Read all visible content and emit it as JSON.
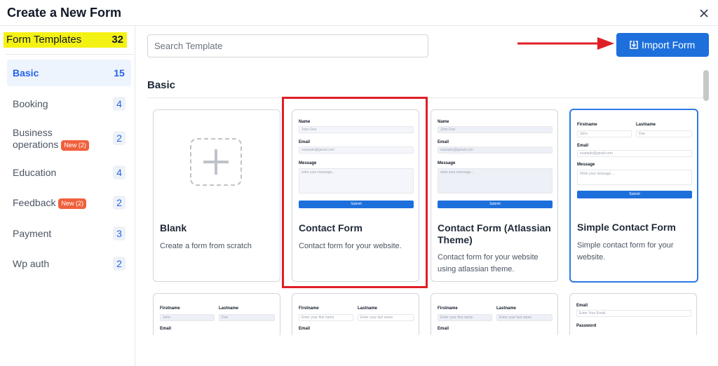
{
  "header": {
    "title": "Create a New Form"
  },
  "sidebar": {
    "heading": {
      "label": "Form Templates",
      "count": "32"
    },
    "items": [
      {
        "label": "Basic",
        "count": "15",
        "active": true
      },
      {
        "label": "Booking",
        "count": "4"
      },
      {
        "label": "Business",
        "label2": "operations",
        "badge": "New (2)",
        "count": "2"
      },
      {
        "label": "Education",
        "count": "4"
      },
      {
        "label": "Feedback",
        "badge": "New (2)",
        "count": "2"
      },
      {
        "label": "Payment",
        "count": "3"
      },
      {
        "label": "Wp auth",
        "count": "2"
      }
    ]
  },
  "search": {
    "placeholder": "Search Template"
  },
  "import_button": {
    "label": "Import Form"
  },
  "section": {
    "title": "Basic"
  },
  "cards": [
    {
      "title": "Blank",
      "desc": "Create a form from scratch"
    },
    {
      "title": "Contact Form",
      "desc": "Contact form for your website."
    },
    {
      "title": "Contact Form (Atlassian Theme)",
      "desc": "Contact form for your website using atlassian theme."
    },
    {
      "title": "Simple Contact Form",
      "desc": "Simple contact form for your website."
    }
  ],
  "preview": {
    "name": "Name",
    "name_ph": "John Doe",
    "email": "Email",
    "email_ph": "example@gmail.com",
    "message": "Message",
    "message_ph": "write your message...",
    "submit": "Submit",
    "firstname": "Firstname",
    "lastname": "Lastname",
    "first_val": "John",
    "last_val": "Doe",
    "write_msg": "Write your message ...",
    "first_ph": "Enter your first name",
    "last_ph": "Enter your last name",
    "email_ph2": "Enter Your Email",
    "password": "Password"
  },
  "colors": {
    "accent": "#1d6fdc",
    "highlight": "#f4f214",
    "annotation": "#e01e26",
    "badge": "#f0603c"
  },
  "icons": {
    "close": "close-icon",
    "import": "import-icon",
    "plus": "plus-icon"
  }
}
